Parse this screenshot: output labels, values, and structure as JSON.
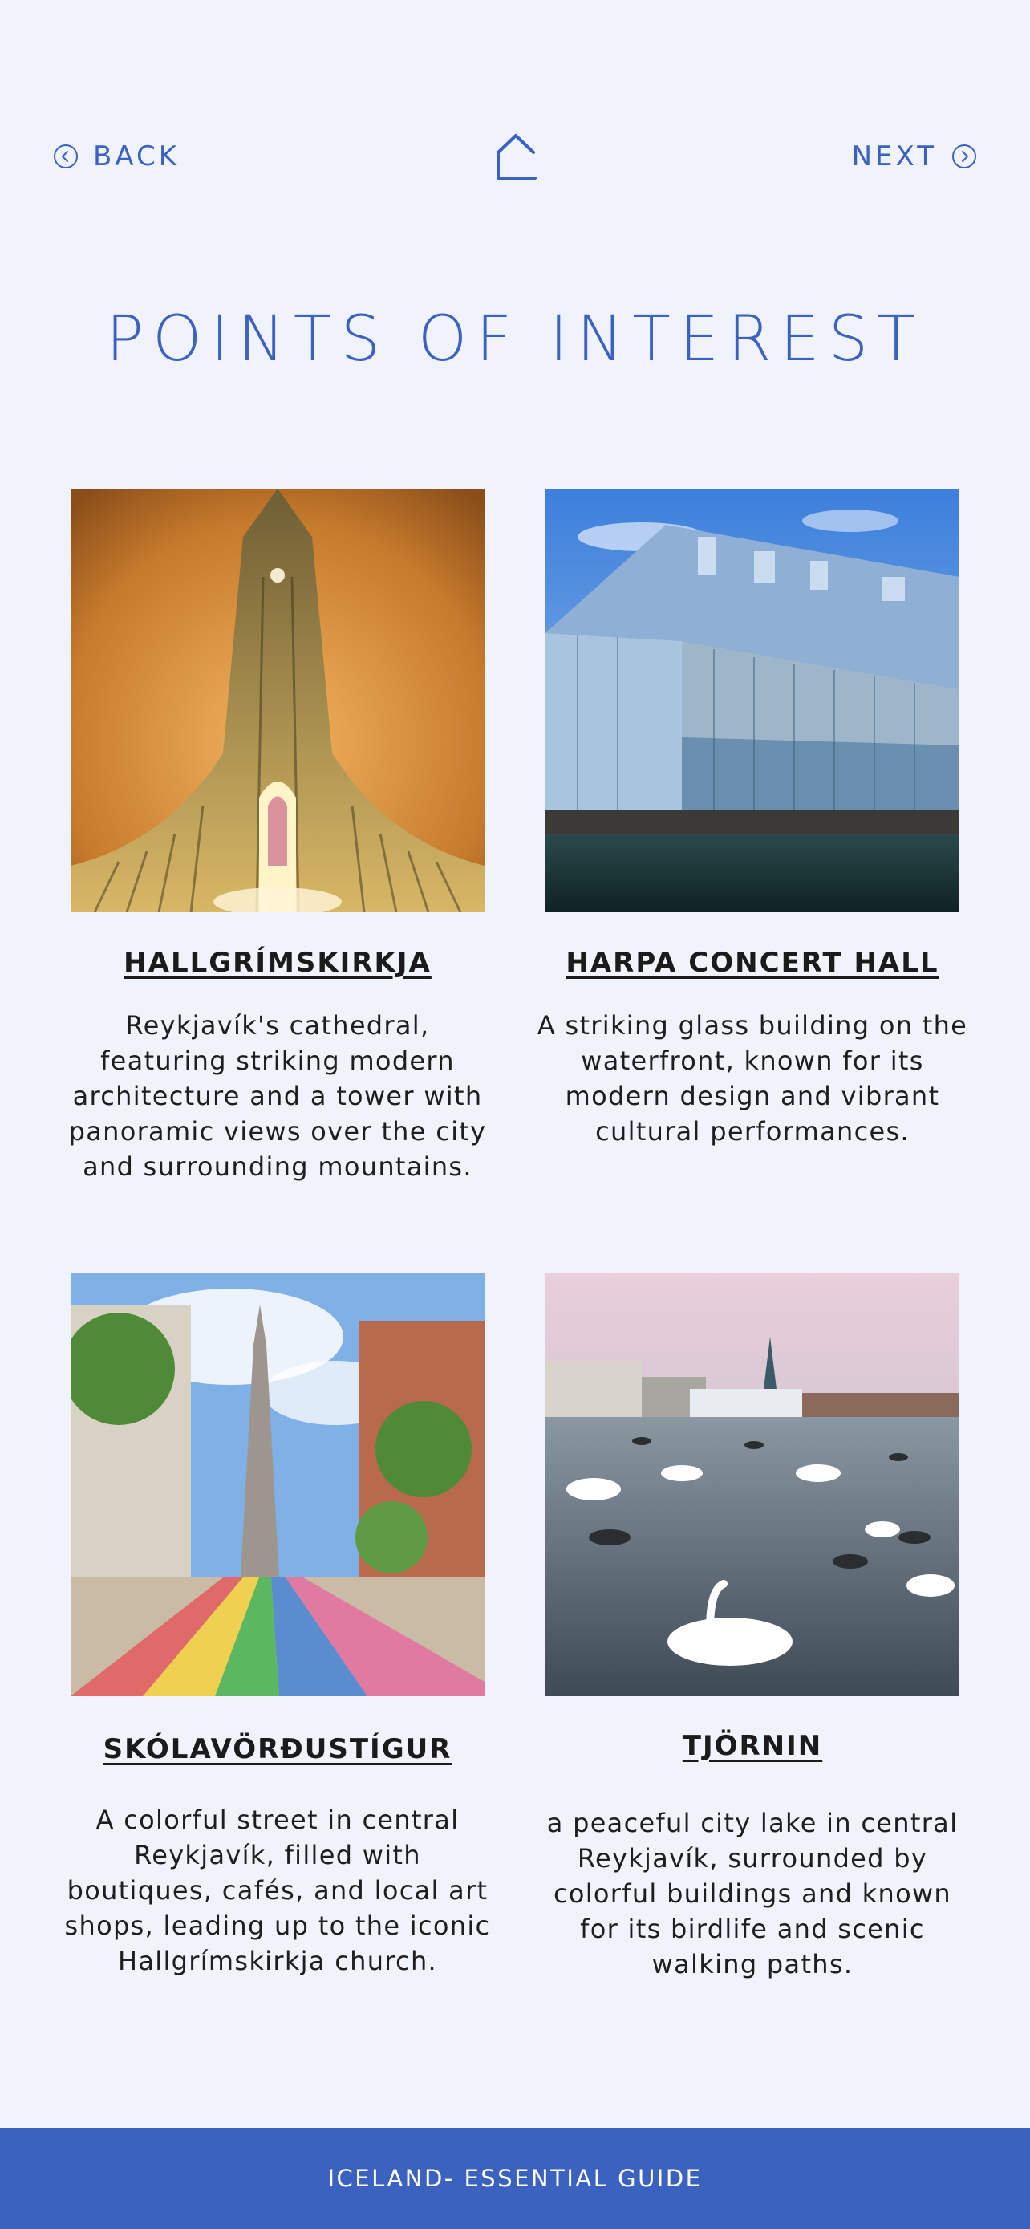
{
  "nav": {
    "back_label": "BACK",
    "next_label": "NEXT",
    "back_icon": "chevron-left-circle-icon",
    "home_icon": "home-icon",
    "next_icon": "chevron-right-circle-icon"
  },
  "page": {
    "title": "POINTS OF INTEREST"
  },
  "cards": [
    {
      "title": "HALLGRÍMSKIRKJA",
      "description": "Reykjavík's cathedral, featuring striking modern architecture and a tower with panoramic views over the city and surrounding mountains."
    },
    {
      "title": "HARPA CONCERT HALL",
      "description": "A striking glass building on the waterfront, known for its modern design and vibrant cultural performances."
    },
    {
      "title": "SKÓLAVÖRÐUSTÍGUR",
      "description": "A colorful street in central Reykjavík, filled with boutiques, cafés, and local art shops, leading up to the iconic Hallgrímskirkja church."
    },
    {
      "title": "TJÖRNIN",
      "description": "a peaceful city lake in central Reykjavík, surrounded by colorful buildings and known for its birdlife and scenic walking paths."
    }
  ],
  "footer": {
    "label": "ICELAND- ESSENTIAL GUIDE"
  },
  "colors": {
    "accent": "#3c62bf",
    "background": "#f1f3fc",
    "text": "#1b1b1b"
  }
}
